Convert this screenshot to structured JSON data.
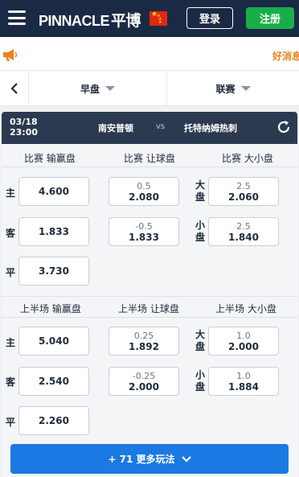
{
  "header": {
    "logo_text": "PINNACLE",
    "logo_cn": "平博",
    "login_label": "登录",
    "register_label": "注册"
  },
  "announcement": {
    "text": "好消息"
  },
  "filters": {
    "market_label": "早盘",
    "league_label": "联赛"
  },
  "match": {
    "date": "03/18",
    "time": "23:00",
    "home": "南安普顿",
    "vs": "vs",
    "away": "托特纳姆热刺"
  },
  "full_time": {
    "moneyline_header": "比赛 输赢盘",
    "handicap_header": "比赛 让球盘",
    "total_header": "比赛 大小盘",
    "home_label": "主",
    "away_label": "客",
    "draw_label": "平",
    "over_label": "大盘",
    "under_label": "小盘",
    "moneyline": {
      "home": "4.600",
      "away": "1.833",
      "draw": "3.730"
    },
    "handicap": {
      "home": {
        "line": "0.5",
        "odds": "2.080"
      },
      "away": {
        "line": "-0.5",
        "odds": "1.833"
      }
    },
    "total": {
      "over": {
        "line": "2.5",
        "odds": "2.060"
      },
      "under": {
        "line": "2.5",
        "odds": "1.840"
      }
    }
  },
  "first_half": {
    "moneyline_header": "上半场 输赢盘",
    "handicap_header": "上半场 让球盘",
    "total_header": "上半场 大小盘",
    "home_label": "主",
    "away_label": "客",
    "draw_label": "平",
    "over_label": "大盘",
    "under_label": "小盘",
    "moneyline": {
      "home": "5.040",
      "away": "2.540",
      "draw": "2.260"
    },
    "handicap": {
      "home": {
        "line": "0.25",
        "odds": "1.892"
      },
      "away": {
        "line": "-0.25",
        "odds": "2.000"
      }
    },
    "total": {
      "over": {
        "line": "1.0",
        "odds": "2.000"
      },
      "under": {
        "line": "1.0",
        "odds": "1.884"
      }
    }
  },
  "more_bets_label": "+ 71 更多玩法",
  "colors": {
    "header_bg": "#1b2a44",
    "register_green": "#19ae4a",
    "match_bar": "#2b3a50",
    "more_button": "#1b79e3",
    "announcement_orange": "#f08020"
  },
  "icons": [
    "hamburger-menu-icon",
    "china-flag-icon",
    "megaphone-icon",
    "chevron-left-icon",
    "caret-down-icon",
    "refresh-icon",
    "chevron-down-icon"
  ]
}
